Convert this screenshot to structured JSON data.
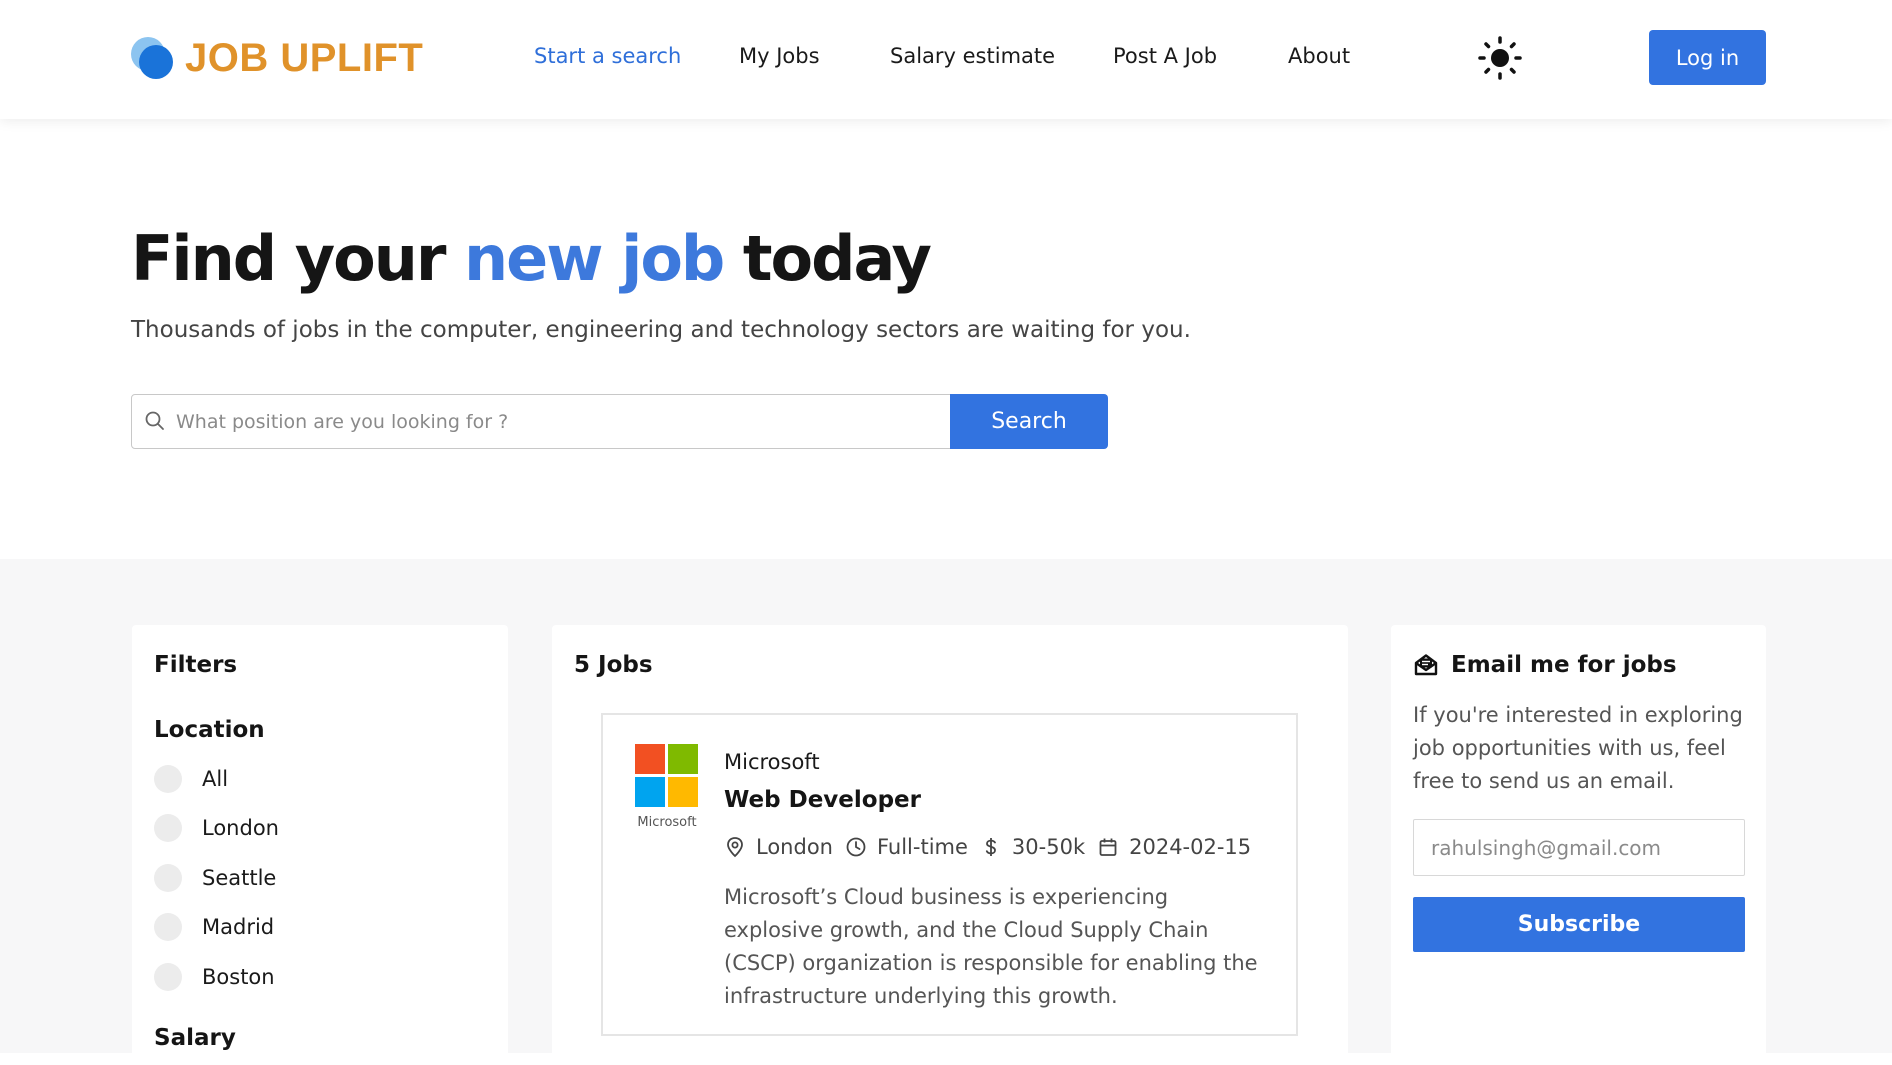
{
  "brand": {
    "name": "JOB UPLIFT",
    "color": "#e0922a"
  },
  "nav": {
    "items": [
      {
        "label": "Start a search",
        "active": true
      },
      {
        "label": "My Jobs"
      },
      {
        "label": "Salary estimate"
      },
      {
        "label": "Post A Job"
      },
      {
        "label": "About"
      }
    ],
    "theme_icon": "sun-icon",
    "login_label": "Log in"
  },
  "hero": {
    "title_pre": "Find your ",
    "title_accent": "new job",
    "title_post": " today",
    "subtitle": "Thousands of jobs in the computer, engineering and technology sectors are waiting for you."
  },
  "search": {
    "placeholder": "What position are you looking for ?",
    "value": "",
    "button_label": "Search"
  },
  "filters": {
    "title": "Filters",
    "location_heading": "Location",
    "locations": [
      "All",
      "London",
      "Seattle",
      "Madrid",
      "Boston"
    ],
    "salary_heading": "Salary"
  },
  "jobs": {
    "count_label": "5 Jobs",
    "items": [
      {
        "company": "Microsoft",
        "logo_caption": "Microsoft",
        "title": "Web Developer",
        "location": "London",
        "type": "Full-time",
        "salary": "30-50k",
        "date": "2024-02-15",
        "description": "Microsoft’s Cloud business is experiencing explosive growth, and the Cloud Supply Chain (CSCP) organization is responsible for enabling the infrastructure underlying this growth."
      }
    ]
  },
  "email_alert": {
    "title": "Email me for jobs",
    "description": "If you're interested in exploring job opportunities with us, feel free to send us an email.",
    "email_value": "",
    "email_placeholder": "rahulsingh@gmail.com",
    "button_label": "Subscribe"
  },
  "colors": {
    "accent": "#3273e0",
    "accent_text": "#3d79dc",
    "section_bg": "#f7f7f8"
  }
}
